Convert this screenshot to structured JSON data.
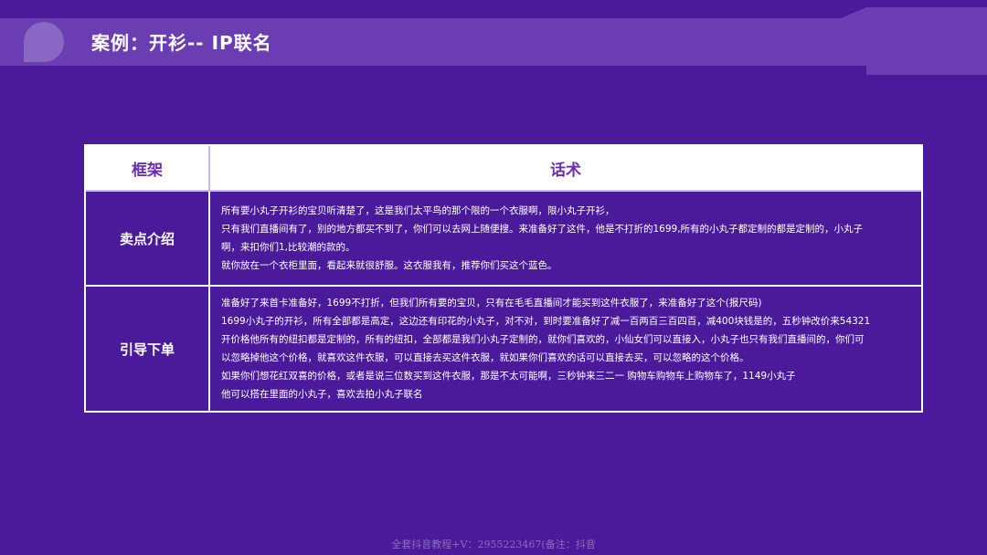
{
  "header": {
    "title": "案例：开衫-- IP联名"
  },
  "table": {
    "headers": [
      "框架",
      "话术"
    ],
    "rows": [
      {
        "label": "卖点介绍",
        "lines": [
          "所有要小丸子开衫的宝贝听清楚了，这是我们太平鸟的那个限的一个衣服啊，限小丸子开衫，",
          "只有我们直播间有了，别的地方都买不到了，你们可以去网上随便搜。来准备好了这件，他是不打折的1699,所有的小丸子都定制的都是定制的，小丸子",
          "啊，来扣你们1,比较潮的款的。",
          "就你放在一个衣柜里面，看起来就很舒服。这衣服我有，推荐你们买这个蓝色。"
        ]
      },
      {
        "label": "引导下单",
        "lines": [
          "准备好了来首卡准备好，1699不打折，但我们所有要的宝贝，只有在毛毛直播间才能买到这件衣服了，来准备好了这个(报尺码)",
          "1699小丸子的开衫，所有全部都是高定，这边还有印花的小丸子，对不对，到时要准备好了减一百两百三百四百，减400块钱是的，五秒钟改价来54321",
          "开价格他所有的纽扣都是定制的，所有的纽扣，全部都是我们小丸子定制的，就你们喜欢的，小仙女们可以直接入，小丸子也只有我们直播间的，你们可",
          "以忽略掉他这个价格，就喜欢这件衣服，可以直接去买这件衣服，就如果你们喜欢的话可以直接去买，可以忽略的这个价格。",
          "如果你们想花红双喜的价格，或者是说三位数买到这件衣服，那是不太可能啊，三秒钟来三二一 购物车购物车上购物车了，1149小丸子",
          "他可以搭在里面的小丸子，喜欢去拍小丸子联名"
        ]
      }
    ]
  },
  "footer": {
    "note": "全套抖音教程+V：2955223467(备注：抖音"
  },
  "colors": {
    "background": "#4b1a9a",
    "header_band": "#6a3eb2",
    "header_text_accent": "#6d2db3",
    "border": "#ffffff"
  }
}
